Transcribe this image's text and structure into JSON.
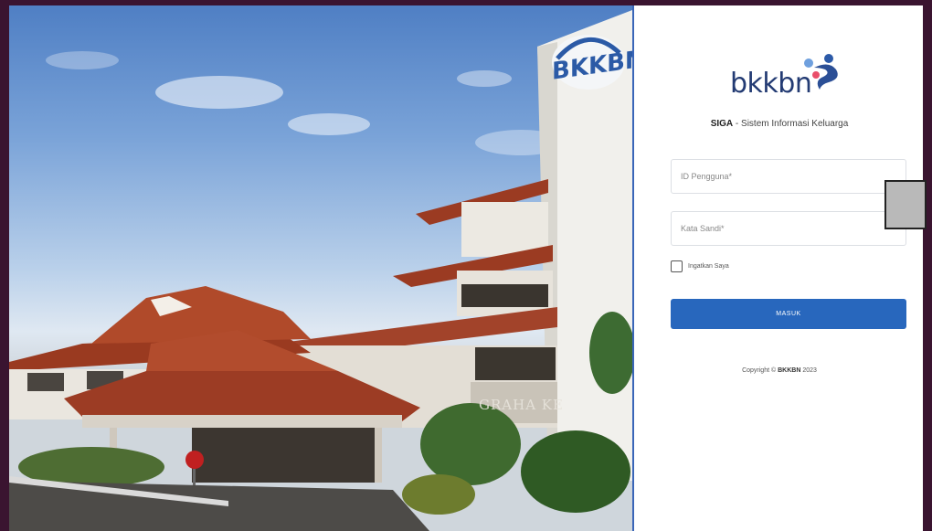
{
  "brand": {
    "logo_text": "bkkbn",
    "logo_icon": "bkkbn-logo-icon"
  },
  "building": {
    "sign_text": "BKKBN",
    "graha_text": "GRAHA KE"
  },
  "subtitle": {
    "app_name": "SIGA",
    "separator": " - ",
    "description": "Sistem Informasi Keluarga"
  },
  "form": {
    "user_placeholder": "ID Pengguna*",
    "password_placeholder": "Kata Sandi*",
    "remember_label": "Ingatkan Saya",
    "submit_label": "MASUK"
  },
  "footer": {
    "copyright_prefix": "Copyright © ",
    "copyright_brand": "BKKBN",
    "copyright_year": " 2023"
  },
  "colors": {
    "primary": "#2867bd",
    "logo_dark": "#233b73",
    "frame_bg": "#3a1430"
  }
}
